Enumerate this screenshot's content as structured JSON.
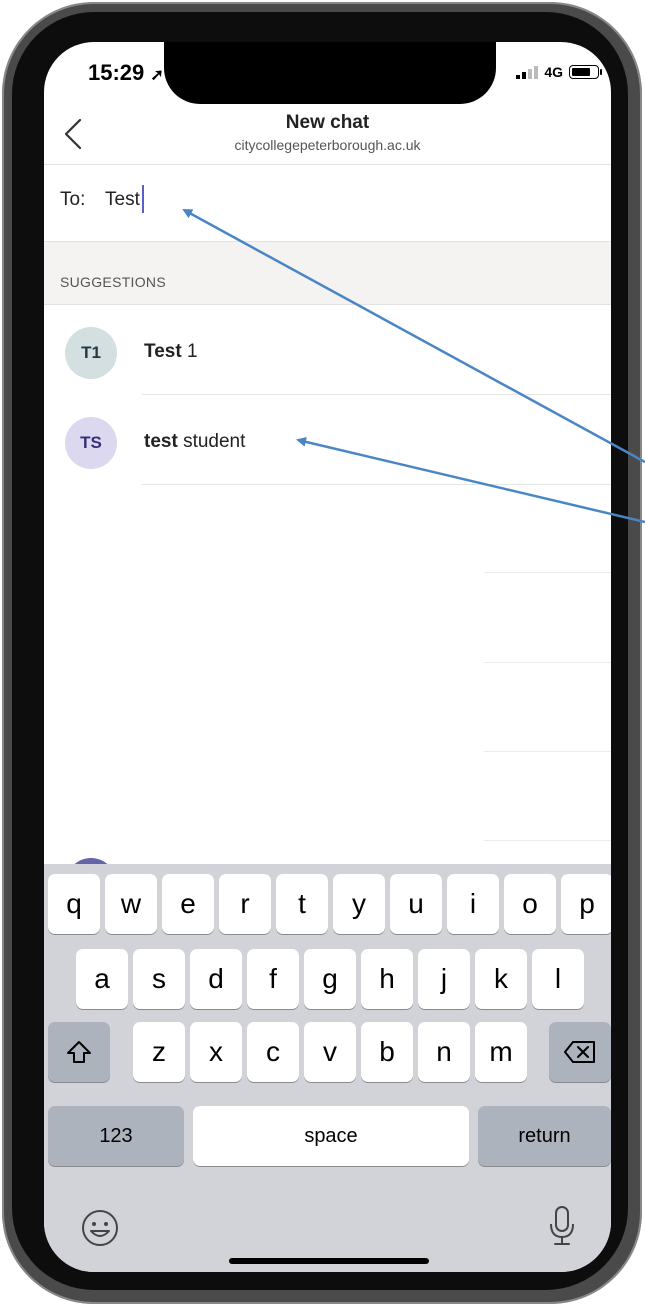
{
  "status_bar": {
    "time": "15:29",
    "network": "4G",
    "battery_level": 0.75
  },
  "header": {
    "title": "New chat",
    "subtitle": "citycollegepeterborough.ac.uk"
  },
  "to_field": {
    "label": "To:",
    "value": "Test"
  },
  "suggestions": {
    "heading": "SUGGESTIONS",
    "items": [
      {
        "initials": "T1",
        "match": "Test",
        "rest": " 1",
        "avatar_bg": "#d3dfe1",
        "avatar_fg": "#233a45"
      },
      {
        "initials": "TS",
        "match": "test",
        "rest": " student",
        "avatar_bg": "#dcd8ef",
        "avatar_fg": "#35307a"
      }
    ]
  },
  "keyboard": {
    "row1": [
      "q",
      "w",
      "e",
      "r",
      "t",
      "y",
      "u",
      "i",
      "o",
      "p"
    ],
    "row2": [
      "a",
      "s",
      "d",
      "f",
      "g",
      "h",
      "j",
      "k",
      "l"
    ],
    "row3": [
      "z",
      "x",
      "c",
      "v",
      "b",
      "n",
      "m"
    ],
    "numbers_label": "123",
    "space_label": "space",
    "return_label": "return"
  },
  "colors": {
    "accent": "#5b5fc7",
    "annotation_arrow": "#4a86c5"
  }
}
